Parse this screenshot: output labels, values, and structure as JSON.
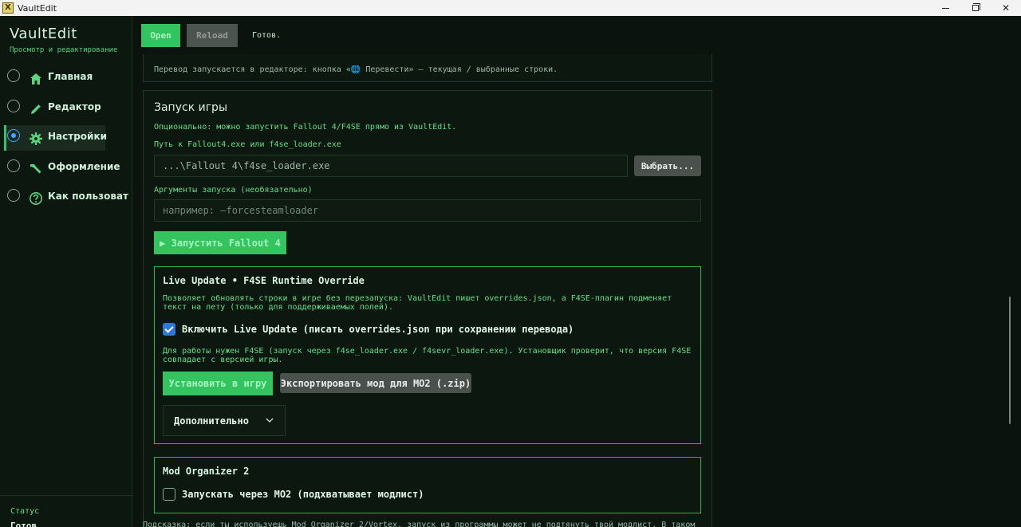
{
  "window": {
    "title": "VaultEdit",
    "icon_letter": "X",
    "controls": [
      "minimize-icon",
      "maximize-icon",
      "close-icon"
    ],
    "close_glyph": "✕"
  },
  "sidebar": {
    "brand_title": "VaultEdit",
    "brand_subtitle": "Просмотр и редактирование",
    "items": [
      {
        "label": "Главная",
        "icon": "home-icon",
        "active": false
      },
      {
        "label": "Редактор",
        "icon": "pencil-icon",
        "active": false
      },
      {
        "label": "Настройки",
        "icon": "gear-icon",
        "active": true
      },
      {
        "label": "Оформление",
        "icon": "brush-icon",
        "active": false
      },
      {
        "label": "Как пользоватьс",
        "icon": "help-icon",
        "active": false
      }
    ],
    "status_label": "Статус",
    "status_value": "Готов"
  },
  "toolbar": {
    "open_label": "Open",
    "reload_label": "Reload",
    "status_text": "Готов."
  },
  "content": {
    "prev_card_text": "Перевод запускается в редакторе: кнопка «🌐 Перевести» — текущая / выбранные строки.",
    "launch": {
      "title": "Запуск игры",
      "description": "Опционально: можно запустить Fallout 4/F4SE прямо из VaultEdit.",
      "path_label": "Путь к Fallout4.exe или f4se_loader.exe",
      "path_value": "...\\Fallout 4\\f4se_loader.exe",
      "browse_label": "Выбрать...",
      "args_label": "Аргументы запуска (необязательно)",
      "args_placeholder": "например: —forcesteamloader",
      "launch_label": "▶ Запустить Fallout 4"
    },
    "live_update": {
      "title": "Live Update • F4SE Runtime Override",
      "description": "Позволяет обновлять строки в игре без перезапуска: VaultEdit пишет overrides.json, а F4SE-плагин подменяет текст на лету (только для поддерживаемых полей).",
      "checkbox_label": "Включить Live Update (писать overrides.json при сохранении перевода)",
      "checkbox_checked": true,
      "note": "Для работы нужен F4SE (запуск через f4se_loader.exe / f4sevr_loader.exe). Установщик проверит, что версия F4SE совпадает с версией игры.",
      "install_label": "Установить в игру",
      "export_label": "Экспортировать мод для MO2 (.zip)",
      "advanced_label": "Дополнительно"
    },
    "mo2": {
      "title": "Mod Organizer 2",
      "checkbox_label": "Запускать через MO2 (подхватывает модлист)",
      "checkbox_checked": false
    },
    "hint": "Подсказка: если ты используешь Mod Organizer 2/Vortex, запуск из программы может не подтянуть твой модлист. В таком"
  },
  "colors": {
    "accent": "#33c460",
    "accent_text": "#a8f5bf",
    "background": "#0a130d",
    "card_border": "#1f3a28",
    "highlight_border": "#2fb359",
    "secondary_button": "#4a504c",
    "checkbox_on": "#2f78d8"
  }
}
